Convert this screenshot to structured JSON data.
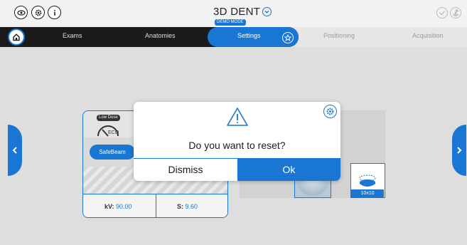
{
  "app": {
    "title": "3D DENT",
    "mode_badge": "DEMO MODE"
  },
  "top_icons": [
    "eye-icon",
    "gear-icon",
    "info-icon"
  ],
  "nav": {
    "items": [
      {
        "label": "Exams",
        "state": "done"
      },
      {
        "label": "Anatomies",
        "state": "done"
      },
      {
        "label": "Settings",
        "state": "active"
      },
      {
        "label": "Positioning",
        "state": "upcoming"
      },
      {
        "label": "Acquisition",
        "state": "upcoming"
      }
    ]
  },
  "card": {
    "low_dose_badge": "Low Dose",
    "eco_label": "ECO",
    "safebeam_label": "SafeBeam",
    "kv_label": "kV:",
    "kv_value": "90.00",
    "s_label": "S:",
    "s_value": "9.60"
  },
  "fov_tile": {
    "label": "10x10"
  },
  "dialog": {
    "message": "Do you want to reset?",
    "dismiss_label": "Dismiss",
    "ok_label": "Ok"
  },
  "colors": {
    "accent": "#1976d2",
    "navbar": "#1a1a1a",
    "background": "#ececec"
  }
}
